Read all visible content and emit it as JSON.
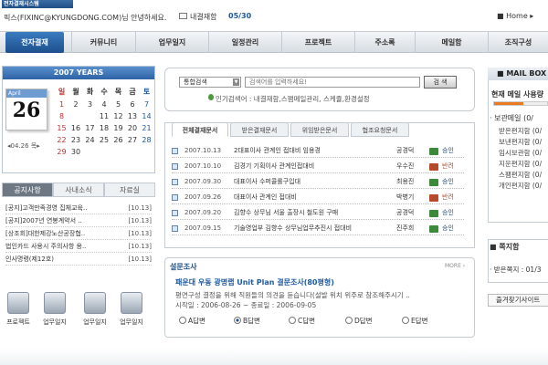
{
  "header": {
    "logo_text": "전자결재시스템",
    "greeting": "픽스(FIXINC@KYUNGDONG.COM)님 안녕하세요.",
    "mail_label": "내결재함",
    "mail_count": "05/30",
    "home": "Home"
  },
  "nav": [
    "전자결재",
    "커뮤니티",
    "업무일지",
    "일정관리",
    "프로젝트",
    "주소록",
    "메일함",
    "조직구성"
  ],
  "calendar": {
    "year_title": "2007 YEARS",
    "month_label": "April",
    "day": "26",
    "badge": "04.26 목",
    "weekdays": [
      "일",
      "월",
      "화",
      "수",
      "목",
      "금",
      "토"
    ],
    "weeks": [
      [
        "",
        "",
        "",
        "",
        "",
        "",
        ""
      ],
      [
        "1",
        "2",
        "3",
        "4",
        "5",
        "6",
        "7"
      ],
      [
        "8",
        "",
        "",
        "11",
        "12",
        "13",
        "14"
      ],
      [
        "15",
        "16",
        "17",
        "18",
        "19",
        "20",
        "21"
      ],
      [
        "22",
        "23",
        "24",
        "25",
        "26",
        "27",
        "28"
      ],
      [
        "29",
        "30",
        "",
        "",
        "",
        "",
        ""
      ]
    ]
  },
  "notice": {
    "tabs": [
      "공지사항",
      "사내소식",
      "자료실"
    ],
    "rows": [
      {
        "title": "[공지]고객만족경영 집체교육..",
        "date": "[10.13]"
      },
      {
        "title": "[공지]2007년 연봉계약서 ..",
        "date": "[10.13]"
      },
      {
        "title": "[상조회]대한제강노산공장협..",
        "date": "[10.13]"
      },
      {
        "title": "법인카드 사용시 주의사항 용..",
        "date": "[10.13]"
      },
      {
        "title": "인사명령(제12호)",
        "date": "[10.13]"
      }
    ]
  },
  "apps": [
    "프로젝트",
    "업무일지",
    "업무일지",
    "업무일지"
  ],
  "search": {
    "select_value": "통합검색",
    "placeholder": "검색어를 입력하세요!",
    "button": "검 색",
    "popular": "인기검색어 : 내결재함,스팸메일관리, 스케쥴,환경설정"
  },
  "docs": {
    "tabs": [
      "전체결재문서",
      "받은결재문서",
      "위임받은문서",
      "협조요청문서"
    ],
    "rows": [
      {
        "date": "2007.10.13",
        "title": "2대표이사 관계인 접대비 임용경",
        "person": "공경덕",
        "status": "승인"
      },
      {
        "date": "2007.10.10",
        "title": "김경기 기획이사 관계인접대비",
        "person": "우수진",
        "status": "반려"
      },
      {
        "date": "2007.09.30",
        "title": "대표이사 수퍼콜롤구입대",
        "person": "최용진",
        "status": "승인"
      },
      {
        "date": "2007.09.26",
        "title": "대표이사 관계인 접대비",
        "person": "박병기",
        "status": "반려"
      },
      {
        "date": "2007.09.20",
        "title": "김향수 상무님 서울 출장시 철도원 구매",
        "person": "공경덕",
        "status": "승인"
      },
      {
        "date": "2007.09.15",
        "title": "기술영업부 김향수 상무님업무추진시 접대비",
        "person": "진주희",
        "status": "승인"
      }
    ]
  },
  "survey": {
    "header": "설문조사",
    "more": "MORE ›",
    "title": "패운대 우동 광명랩 Unit Plan 결문조사(80평형)",
    "desc": "평면구성 결정을 위해 직원들의 의견을 듣습니다(설발 위치 위주로 참조해주시기 ..",
    "period": "시작일 : 2006-08-26 ~ 종료일 : 2006-09-05",
    "options": [
      {
        "label": "A답변",
        "selected": false
      },
      {
        "label": "B답변",
        "selected": true
      },
      {
        "label": "C답변",
        "selected": false
      },
      {
        "label": "D답변",
        "selected": false
      },
      {
        "label": "E답변",
        "selected": false
      }
    ]
  },
  "mailbox": {
    "title": "MAIL BOX",
    "usage": "현재 메일 사용량",
    "usage_fraction": 0.55,
    "boxes_header": "· 보관메일 (0/",
    "boxes": [
      "받은편지함 (0/",
      "보낸편지함 (0/",
      "임시보관함 (0/",
      "지운편지함 (0/",
      "스팸편지함 (0/",
      "개인편지함 (0/"
    ]
  },
  "note": {
    "title": "쪽지함",
    "received": "· 받은쪽지 : 01/3"
  },
  "favorites": "즐겨찾기사이트",
  "colors": {
    "accent": "#1f4f86",
    "status_approve": "#3a8a3a",
    "status_reject": "#b84a2a",
    "usage_bar": "#e87a22"
  }
}
